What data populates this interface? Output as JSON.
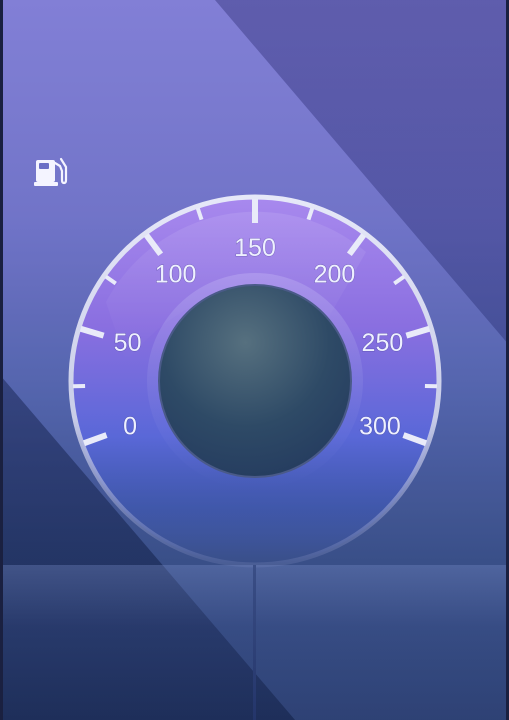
{
  "status": {
    "fuel_icon": "fuel-pump-icon"
  },
  "gauge": {
    "min": 0,
    "max": 300,
    "major_labels": [
      "0",
      "50",
      "100",
      "150",
      "200",
      "250",
      "300"
    ],
    "minor_ticks": [
      25,
      75,
      125,
      175,
      225,
      275
    ],
    "accent_top": "#a986ee",
    "accent_bottom": "#4b62d6",
    "rim_color": "#d9dcef",
    "hub_color": "#2e4a66"
  },
  "bottom_panel": {
    "left_button": "",
    "right_button": ""
  }
}
